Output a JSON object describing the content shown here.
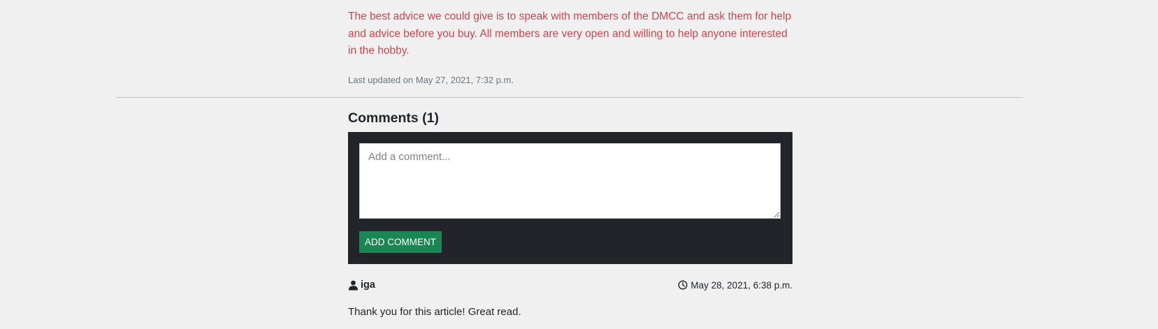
{
  "article": {
    "advice_text": "The best advice we could give is to speak with members of the DMCC and ask them for help and advice before you buy. All members are very open and willing to help anyone interested in the hobby.",
    "last_updated": "Last updated on May 27, 2021, 7:32 p.m."
  },
  "comments": {
    "heading": "Comments (1)",
    "form": {
      "placeholder": "Add a comment...",
      "value": "",
      "submit_label": "ADD COMMENT"
    },
    "items": [
      {
        "author": "iga",
        "author_icon": "user-icon",
        "date": "May 28, 2021, 6:38 p.m.",
        "date_icon": "clock-icon",
        "body": "Thank you for this article! Great read."
      }
    ]
  },
  "colors": {
    "advice_text": "#d1454f",
    "form_background": "#212529",
    "button_background": "#198754",
    "page_background": "#f0f0f0"
  }
}
